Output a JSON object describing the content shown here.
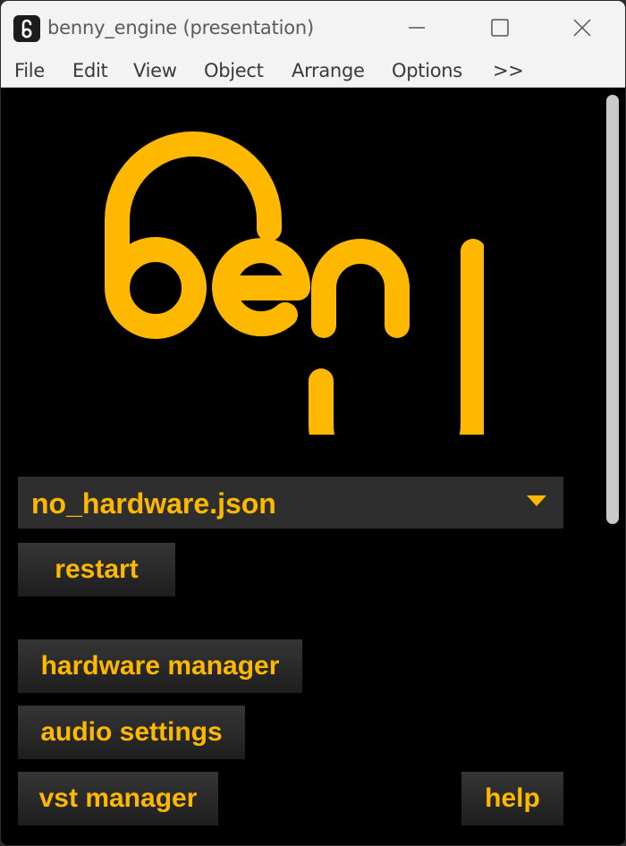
{
  "window": {
    "title": "benny_engine (presentation)",
    "app_icon": "benny-app-icon",
    "controls": [
      "minimize-icon",
      "maximize-icon",
      "close-icon"
    ]
  },
  "menu": {
    "items": [
      "File",
      "Edit",
      "View",
      "Object",
      "Arrange",
      "Options",
      ">>"
    ]
  },
  "logo": {
    "text": "benny"
  },
  "config_select": {
    "value": "no_hardware.json",
    "icon": "triangle-down-icon"
  },
  "buttons": {
    "restart": "restart",
    "hardware_manager": "hardware manager",
    "audio_settings": "audio settings",
    "vst_manager": "vst manager",
    "help": "help"
  },
  "colors": {
    "accent": "#ffb800",
    "background": "#000000",
    "button": "#2e2e2e",
    "titlebar": "#f3f3f3"
  }
}
